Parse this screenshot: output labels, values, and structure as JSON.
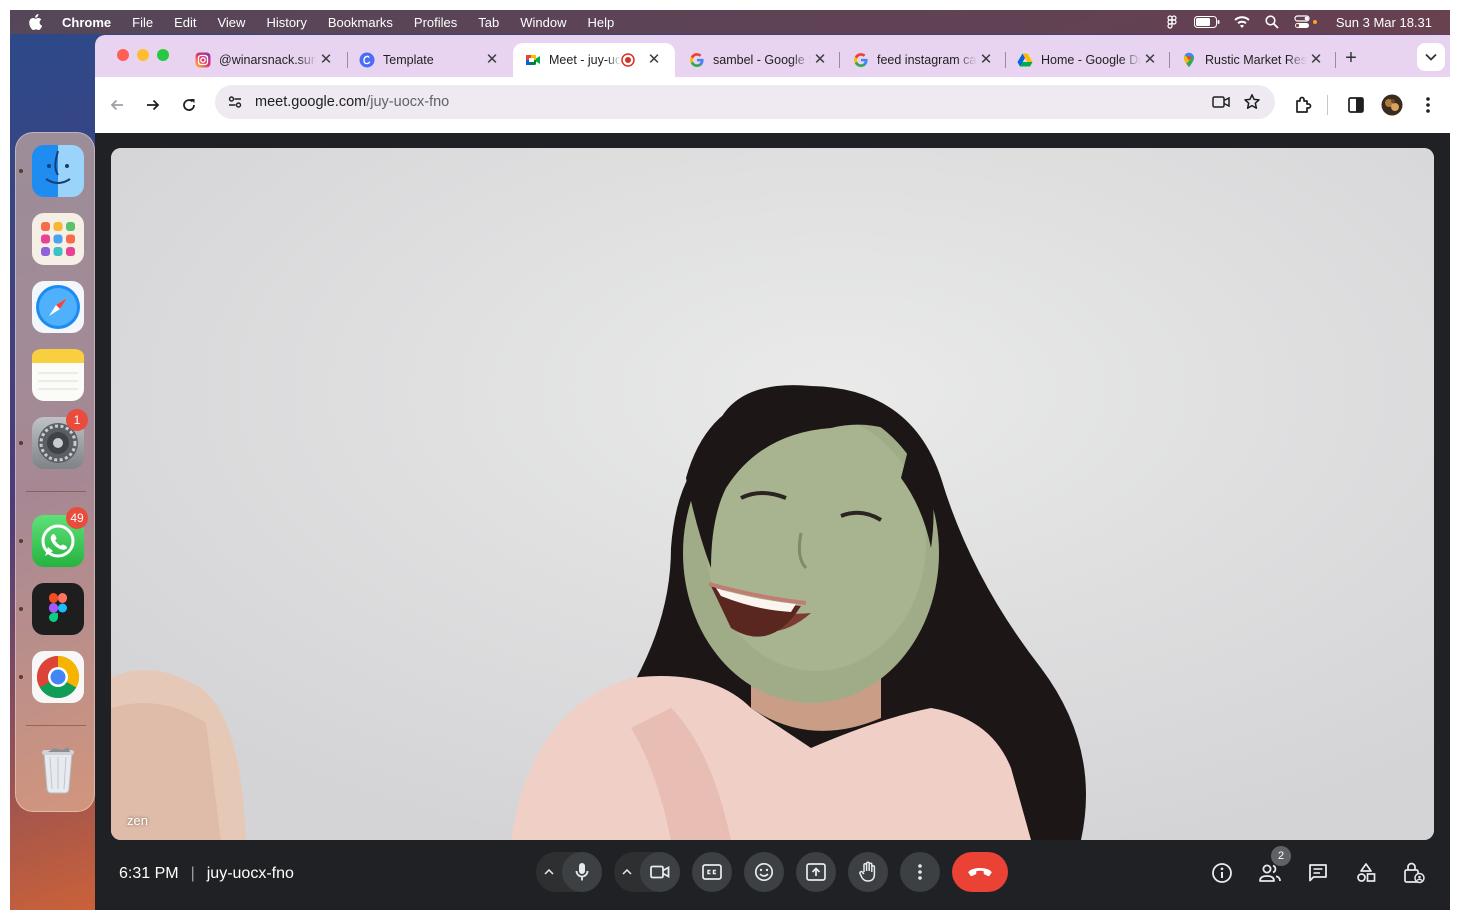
{
  "menubar": {
    "app_name": "Chrome",
    "items": [
      "File",
      "Edit",
      "View",
      "History",
      "Bookmarks",
      "Profiles",
      "Tab",
      "Window",
      "Help"
    ],
    "clock": "Sun 3 Mar  18.31"
  },
  "dock": {
    "apps": [
      {
        "name": "Finder",
        "icon": "finder-icon"
      },
      {
        "name": "Launchpad",
        "icon": "launchpad-icon"
      },
      {
        "name": "Safari",
        "icon": "safari-icon"
      },
      {
        "name": "Notes",
        "icon": "notes-icon"
      },
      {
        "name": "System Settings",
        "icon": "settings-icon",
        "badge": "1"
      },
      {
        "name": "WhatsApp",
        "icon": "whatsapp-icon",
        "badge": "49"
      },
      {
        "name": "Figma",
        "icon": "figma-icon"
      },
      {
        "name": "Google Chrome",
        "icon": "chrome-icon"
      },
      {
        "name": "Trash",
        "icon": "trash-icon"
      }
    ]
  },
  "tabs": [
    {
      "label": "@winarsnack.surabaya",
      "icon": "instagram-icon",
      "close": "✕"
    },
    {
      "label": "Template",
      "icon": "canva-icon",
      "close": "✕"
    },
    {
      "label": "Meet - juy-uocx-fno",
      "icon": "meet-icon",
      "close": "✕",
      "active": true
    },
    {
      "label": "sambel - Google Search",
      "icon": "google-icon",
      "close": "✕"
    },
    {
      "label": "feed instagram cafe",
      "icon": "google-icon",
      "close": "✕"
    },
    {
      "label": "Home - Google Drive",
      "icon": "drive-icon",
      "close": "✕"
    },
    {
      "label": "Rustic Market Resto",
      "icon": "maps-icon",
      "close": "✕"
    }
  ],
  "toolbar": {
    "url_host": "meet.google.com",
    "url_path": "/juy-uocx-fno"
  },
  "meet": {
    "participant_name": "zen",
    "time": "6:31 PM",
    "meeting_code": "juy-uocx-fno",
    "people_count": "2",
    "accent_hangup": "#ea4335"
  }
}
